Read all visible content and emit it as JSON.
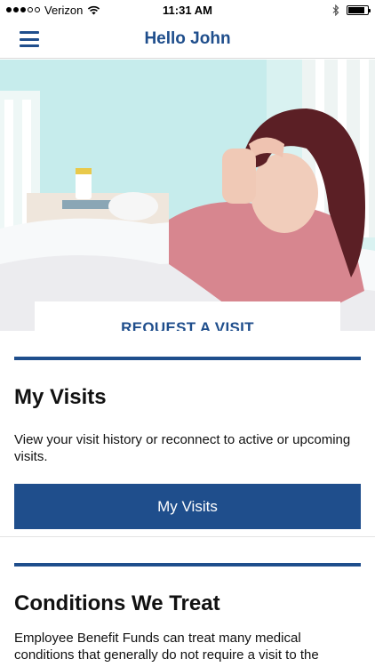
{
  "status_bar": {
    "carrier": "Verizon",
    "time": "11:31 AM",
    "signal_bars_filled": 3,
    "signal_bars_total": 5,
    "battery_level": 0.85
  },
  "header": {
    "title": "Hello John",
    "menu_icon": "hamburger-menu-icon"
  },
  "hero": {
    "request_label": "REQUEST A VISIT"
  },
  "my_visits": {
    "title": "My Visits",
    "description": "View your visit history or reconnect to active or upcoming visits.",
    "button_label": "My Visits"
  },
  "conditions": {
    "title": "Conditions We Treat",
    "description": "Employee Benefit Funds can treat many medical conditions that generally do not require a visit to the"
  },
  "colors": {
    "brand_blue": "#1f4e8c"
  }
}
